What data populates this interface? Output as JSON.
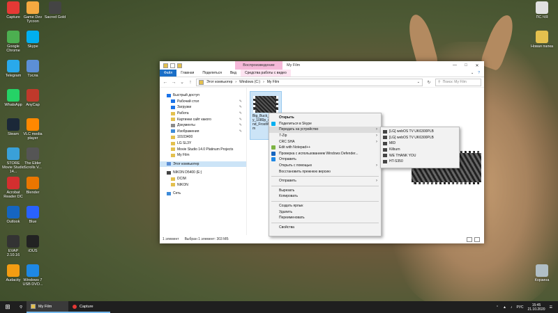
{
  "desktop_icons": [
    {
      "label": "Capture",
      "icon": "capture-icon",
      "color": "#e53935"
    },
    {
      "label": "Google Chrome",
      "icon": "chrome-icon",
      "color": "#4caf50"
    },
    {
      "label": "Telegram",
      "icon": "telegram-icon",
      "color": "#29a9eb"
    },
    {
      "label": "WhatsApp",
      "icon": "whatsapp-icon",
      "color": "#25d366"
    },
    {
      "label": "Steam",
      "icon": "steam-icon",
      "color": "#1b2838"
    },
    {
      "label": "STORE Movie Studio 14...",
      "icon": "movie-studio-icon",
      "color": "#3aa0d8"
    },
    {
      "label": "Acrobat Reader DC",
      "icon": "acrobat-icon",
      "color": "#d32f2f"
    },
    {
      "label": "Outlook",
      "icon": "outlook-icon",
      "color": "#1565c0"
    },
    {
      "label": "EVAP 2.10.16",
      "icon": "evap-icon",
      "color": "#333333"
    },
    {
      "label": "Audacity",
      "icon": "audacity-icon",
      "color": "#f39c12"
    },
    {
      "label": "Game Dev Tycoon",
      "icon": "game-dev-icon",
      "color": "#f4a940"
    },
    {
      "label": "Skype",
      "icon": "skype-icon",
      "color": "#00aff0"
    },
    {
      "label": "Тэсла",
      "icon": "monitor-icon",
      "color": "#5c8fd6"
    },
    {
      "label": "AnyCap",
      "icon": "anycap-icon",
      "color": "#c0392b"
    },
    {
      "label": "VLC media player",
      "icon": "vlc-icon",
      "color": "#ff8800"
    },
    {
      "label": "The Elder Scrolls V...",
      "icon": "elder-scrolls-icon",
      "color": "#555555"
    },
    {
      "label": "Blender",
      "icon": "blender-icon",
      "color": "#ea7600"
    },
    {
      "label": "Blue",
      "icon": "blue-icon",
      "color": "#2962ff"
    },
    {
      "label": "iOUS",
      "icon": "ious-icon",
      "color": "#222222"
    },
    {
      "label": "Windows 7 USB DVD...",
      "icon": "usb-dvd-icon",
      "color": "#1e88e5"
    },
    {
      "label": "Sacred Gold",
      "icon": "sacred-gold-icon",
      "color": "#444444"
    },
    {
      "label": "ПС.ЧЯ",
      "icon": "document-icon",
      "color": "#e0e0e0"
    },
    {
      "label": "Новая папка",
      "icon": "folder-icon",
      "color": "#e3c04e"
    },
    {
      "label": "Корзина",
      "icon": "recycle-bin-icon",
      "color": "#b0bec5"
    }
  ],
  "explorer": {
    "context_tab": "Воспроизведение",
    "title": "My Film",
    "ribbon_tabs": [
      "Файл",
      "Главная",
      "Поделиться",
      "Вид",
      "Средства работы с видео"
    ],
    "address_crumbs": [
      "Этот компьютер",
      "Windows (C:)",
      "My Film"
    ],
    "search_placeholder": "Поиск: My Film",
    "nav_items": [
      {
        "label": "Быстрый доступ",
        "icon": "star-icon",
        "color": "#1a73e8",
        "indent": false,
        "pinned": false,
        "selected": false
      },
      {
        "label": "Рабочий стол",
        "icon": "desktop-folder-icon",
        "color": "#1a73e8",
        "indent": true,
        "pinned": true,
        "selected": false
      },
      {
        "label": "Загрузки",
        "icon": "download-icon",
        "color": "#1a73e8",
        "indent": true,
        "pinned": true,
        "selected": false
      },
      {
        "label": "Работа",
        "icon": "folder-icon",
        "color": "#e3c04e",
        "indent": true,
        "pinned": true,
        "selected": false
      },
      {
        "label": "Картинки сайт какого",
        "icon": "folder-icon",
        "color": "#e3c04e",
        "indent": true,
        "pinned": true,
        "selected": false
      },
      {
        "label": "Документы",
        "icon": "documents-icon",
        "color": "#8a8a8a",
        "indent": true,
        "pinned": true,
        "selected": false
      },
      {
        "label": "Изображения",
        "icon": "pictures-icon",
        "color": "#3d8bd9",
        "indent": true,
        "pinned": true,
        "selected": false
      },
      {
        "label": "10103400",
        "icon": "folder-icon",
        "color": "#e3c04e",
        "indent": true,
        "pinned": false,
        "selected": false
      },
      {
        "label": "LG SL3Y",
        "icon": "folder-icon",
        "color": "#e3c04e",
        "indent": true,
        "pinned": false,
        "selected": false
      },
      {
        "label": "Movie Studio 14.0 Platinum Projects",
        "icon": "folder-icon",
        "color": "#e3c04e",
        "indent": true,
        "pinned": false,
        "selected": false
      },
      {
        "label": "My Film",
        "icon": "folder-icon",
        "color": "#e3c04e",
        "indent": true,
        "pinned": false,
        "selected": false
      },
      {
        "label": "Этот компьютер",
        "icon": "computer-icon",
        "color": "#5c8fd6",
        "indent": false,
        "pinned": false,
        "selected": true
      },
      {
        "label": "NIKON D5400 (E:)",
        "icon": "camera-icon",
        "color": "#444444",
        "indent": false,
        "pinned": false,
        "selected": false
      },
      {
        "label": "DCIM",
        "icon": "folder-icon",
        "color": "#e3c04e",
        "indent": true,
        "pinned": false,
        "selected": false
      },
      {
        "label": "NIKON",
        "icon": "folder-icon",
        "color": "#e3c04e",
        "indent": true,
        "pinned": false,
        "selected": false
      },
      {
        "label": "Сеть",
        "icon": "network-icon",
        "color": "#3d8bd9",
        "indent": false,
        "pinned": false,
        "selected": false
      }
    ],
    "file": {
      "name": "Big_Buck_Bunny_1080p_surround_FrostWire.com"
    },
    "status": {
      "count": "1 элемент",
      "selected": "Выбран 1 элемент: 303 МБ"
    }
  },
  "context_menu": [
    {
      "label": "Открыть",
      "bold": true
    },
    {
      "label": "Поделиться в Skype",
      "icon": "skype-icon",
      "color": "#00aff0"
    },
    {
      "label": "Передать на устройство",
      "submenu": true,
      "hover": true
    },
    {
      "label": "7-Zip",
      "submenu": true
    },
    {
      "label": "CRC SHA",
      "submenu": true
    },
    {
      "label": "Edit with Notepad++",
      "icon": "notepad-icon",
      "color": "#7cb342"
    },
    {
      "label": "Проверка с использованием Windows Defender...",
      "icon": "defender-icon",
      "color": "#1565c0"
    },
    {
      "label": "Отправить",
      "icon": "share-icon",
      "color": "#1e88e5"
    },
    {
      "label": "Открыть с помощью",
      "submenu": true
    },
    {
      "label": "Восстановить прежнюю версию"
    },
    {
      "separator": true
    },
    {
      "label": "Отправить",
      "submenu": true
    },
    {
      "separator": true
    },
    {
      "label": "Вырезать"
    },
    {
      "label": "Копировать"
    },
    {
      "separator": true
    },
    {
      "label": "Создать ярлык"
    },
    {
      "label": "Удалить"
    },
    {
      "label": "Переименовать"
    },
    {
      "separator": true
    },
    {
      "label": "Свойства"
    }
  ],
  "submenu": [
    {
      "label": "[LG] webOS TV UK6300PLB"
    },
    {
      "label": "[LG] webOS TV UK6300PLB"
    },
    {
      "label": "MID"
    },
    {
      "label": "Kilburn"
    },
    {
      "label": "WE THANK YOU"
    },
    {
      "label": "HT-S350"
    }
  ],
  "taskbar": {
    "items": [
      {
        "label": "My Film",
        "icon": "folder-icon",
        "color": "#e3c04e"
      },
      {
        "label": "Capture",
        "icon": "capture-icon",
        "color": "#e53935"
      }
    ],
    "lang": "РУС",
    "time": "15:45",
    "date": "21.10.2020"
  }
}
